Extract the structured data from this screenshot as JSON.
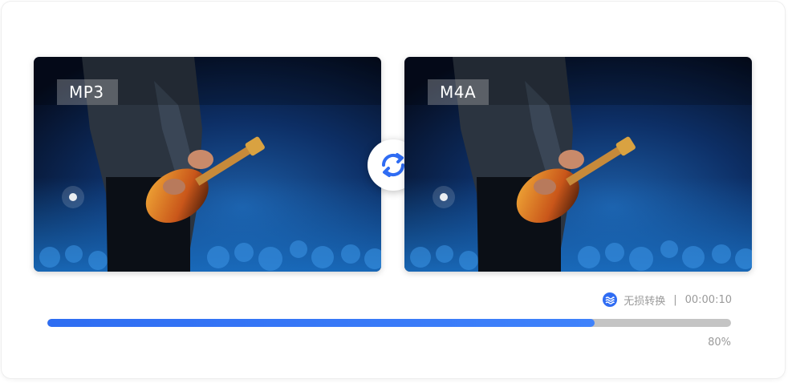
{
  "panels": [
    {
      "format": "MP3",
      "image": "concert-guitarist-photo"
    },
    {
      "format": "M4A",
      "image": "concert-guitarist-photo"
    }
  ],
  "convert_icon": "refresh-icon",
  "status": {
    "mode_icon": "wave-icon",
    "mode_label": "无损转换",
    "separator": "|",
    "time": "00:00:10"
  },
  "progress": {
    "value": 0.8,
    "percent_label": "80%"
  },
  "colors": {
    "accent": "#2f6cf3",
    "track": "#c4c4c4",
    "muted_text": "#9a9a9a"
  }
}
